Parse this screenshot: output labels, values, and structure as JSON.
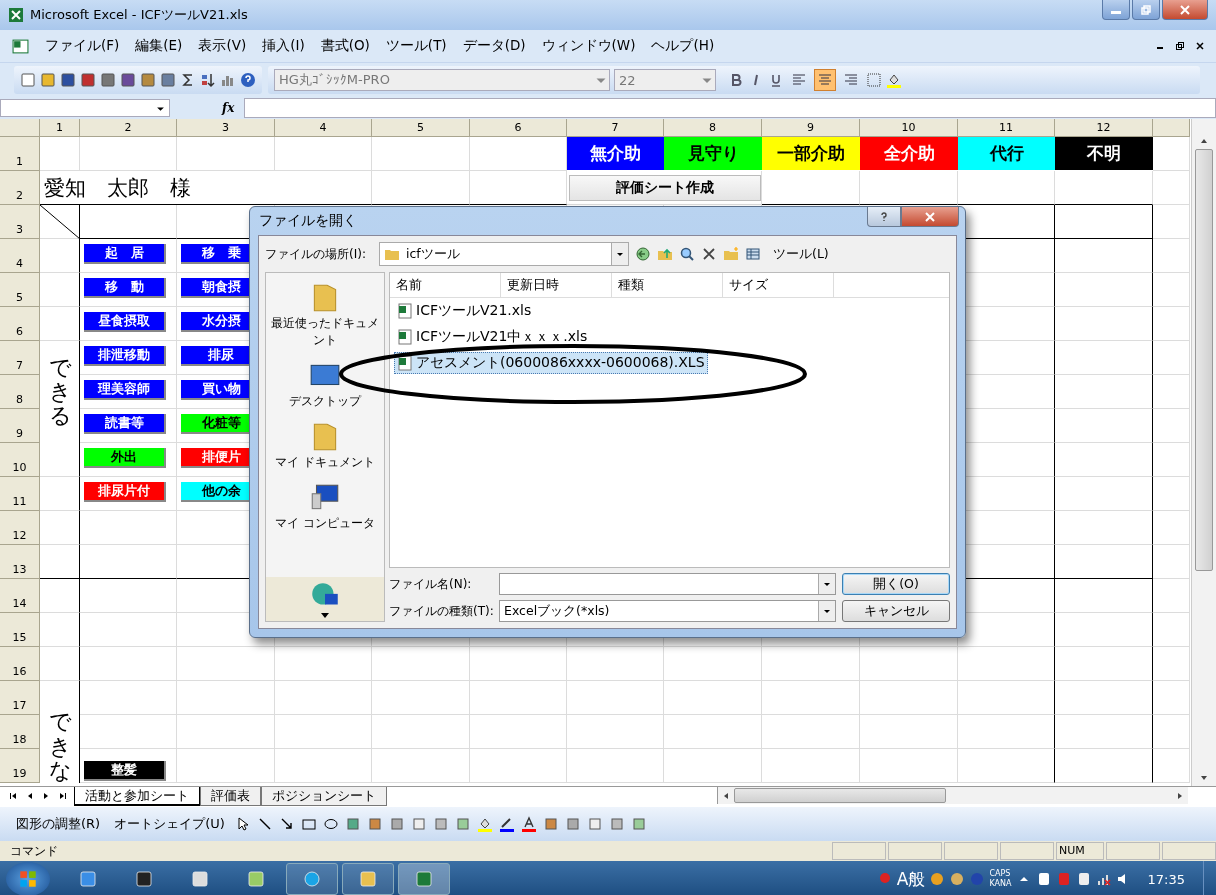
{
  "window": {
    "title": "Microsoft Excel - ICFツールV21.xls"
  },
  "menu": [
    "ファイル(F)",
    "編集(E)",
    "表示(V)",
    "挿入(I)",
    "書式(O)",
    "ツール(T)",
    "データ(D)",
    "ウィンドウ(W)",
    "ヘルプ(H)"
  ],
  "formatting": {
    "font": "HG丸ｺﾞｼｯｸM-PRO",
    "size": "22",
    "align_buttons": [
      {
        "selected": false
      },
      {
        "selected": true
      },
      {
        "selected": false
      }
    ]
  },
  "formula_bar": {
    "function_label": "fx"
  },
  "sheet": {
    "columns": [
      "1",
      "2",
      "3",
      "4",
      "5",
      "6",
      "7",
      "8",
      "9",
      "10",
      "11",
      "12"
    ],
    "rows": [
      "1",
      "2",
      "3",
      "4",
      "5",
      "6",
      "7",
      "8",
      "9",
      "10",
      "11",
      "12",
      "13",
      "14",
      "15",
      "16",
      "17",
      "18",
      "19"
    ],
    "legend": [
      {
        "label": "無介助",
        "color": "#0000ff"
      },
      {
        "label": "見守り",
        "color": "#00ff00"
      },
      {
        "label": "一部介助",
        "color": "#ffff00"
      },
      {
        "label": "全介助",
        "color": "#ff0000"
      },
      {
        "label": "代行",
        "color": "#00ffff"
      },
      {
        "label": "不明",
        "color": "#000000"
      }
    ],
    "create_button": "評価シート作成",
    "client_name": "愛知　太郎　様",
    "can_label": "できる",
    "cannot_label": "できな",
    "activity_columns": [
      [
        {
          "label": "起　居",
          "color": "#0000ff"
        },
        {
          "label": "移　動",
          "color": "#0000ff"
        },
        {
          "label": "昼食摂取",
          "color": "#0000ff"
        },
        {
          "label": "排泄移動",
          "color": "#0000ff"
        },
        {
          "label": "理美容師",
          "color": "#0000ff"
        },
        {
          "label": "読書等",
          "color": "#0000ff"
        },
        {
          "label": "外出",
          "color": "#00ff00"
        },
        {
          "label": "排尿片付",
          "color": "#ff0000"
        }
      ],
      [
        {
          "label": "移　乗",
          "color": "#0000ff"
        },
        {
          "label": "朝食摂",
          "color": "#0000ff"
        },
        {
          "label": "水分摂",
          "color": "#0000ff"
        },
        {
          "label": "排尿",
          "color": "#0000ff"
        },
        {
          "label": "買い物",
          "color": "#0000ff"
        },
        {
          "label": "化粧等",
          "color": "#00ff00"
        },
        {
          "label": "排便片",
          "color": "#ff0000"
        },
        {
          "label": "他の余",
          "color": "#00ffff"
        }
      ]
    ],
    "bottom_item": {
      "label": "整髪",
      "color": "#000000"
    }
  },
  "dialog": {
    "title": "ファイルを開く",
    "location_label": "ファイルの場所(I):",
    "location": "icfツール",
    "tools": "ツール(L)",
    "places": [
      "最近使ったドキュメント",
      "デスクトップ",
      "マイ ドキュメント",
      "マイ コンピュータ"
    ],
    "columns": [
      "名前",
      "更新日時",
      "種類",
      "サイズ"
    ],
    "files": [
      {
        "name": "ICFツールV21.xls",
        "selected": false
      },
      {
        "name": "ICFツールV21中ｘｘｘ.xls",
        "selected": false
      },
      {
        "name": "アセスメント(0600086xxxx-0600068).XLS",
        "selected": true
      }
    ],
    "filename_label": "ファイル名(N):",
    "filetype_label": "ファイルの種類(T):",
    "filetype": "Excelブック(*xls)",
    "open_button": "開く(O)",
    "cancel_button": "キャンセル"
  },
  "sheet_tabs": [
    {
      "label": "活動と参加シート",
      "selected": true
    },
    {
      "label": "評価表",
      "selected": false
    },
    {
      "label": "ポジションシート",
      "selected": false
    }
  ],
  "drawing_toolbar": {
    "adjust": "図形の調整(R)",
    "autoshape": "オートシェイプ(U)"
  },
  "status_bar": {
    "mode": "コマンド",
    "num": "NUM"
  },
  "taskbar": {
    "ime": "A般",
    "caps": "CAPS",
    "kana": "KANA",
    "time": "17:35"
  }
}
